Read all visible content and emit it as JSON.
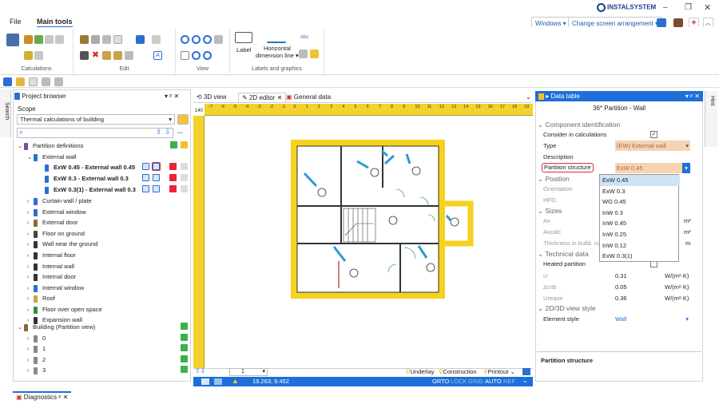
{
  "app": {
    "brand": "INSTALSYSTEM",
    "window_windows": "Windows",
    "window_arrangement": "Change screen arrangement"
  },
  "menu": {
    "file": "File",
    "main_tools": "Main tools"
  },
  "ribbon": {
    "calculations": "Calculations",
    "edit": "Edit",
    "view": "View",
    "labels_graphics": "Labels and graphics",
    "label_btn": "Label",
    "dim_btn_1": "Horizontal",
    "dim_btn_2": "dimension line"
  },
  "project_browser": {
    "title": "Project browser",
    "scope_label": "Scope",
    "scope_value": "Thermal calculations of building",
    "tree": [
      {
        "label": "Partition definitions",
        "level": 0,
        "expanded": true,
        "bold": false
      },
      {
        "label": "External wall",
        "level": 1,
        "expanded": true,
        "bold": false
      },
      {
        "label": "ExW 0.45 - External wall 0.45",
        "level": 2,
        "bold": true
      },
      {
        "label": "ExW 0.3 - External wall 0.3",
        "level": 2,
        "bold": true
      },
      {
        "label": "ExW 0.3(1) - External wall 0.3",
        "level": 2,
        "bold": true
      },
      {
        "label": "Curtain wall / plate",
        "level": 1
      },
      {
        "label": "External window",
        "level": 1
      },
      {
        "label": "External door",
        "level": 1
      },
      {
        "label": "Floor on ground",
        "level": 1
      },
      {
        "label": "Wall near the ground",
        "level": 1
      },
      {
        "label": "Internal floor",
        "level": 1
      },
      {
        "label": "Internal wall",
        "level": 1
      },
      {
        "label": "Internal door",
        "level": 1
      },
      {
        "label": "Internal window",
        "level": 1
      },
      {
        "label": "Roof",
        "level": 1
      },
      {
        "label": "Floor over open space",
        "level": 1
      },
      {
        "label": "Expansion wall",
        "level": 1
      },
      {
        "label": "Building (Partition view)",
        "level": 0,
        "expanded": true
      },
      {
        "label": "0",
        "level": 1
      },
      {
        "label": "1",
        "level": 1
      },
      {
        "label": "2",
        "level": 1
      },
      {
        "label": "3",
        "level": 1
      }
    ]
  },
  "side_tab_left": "Search",
  "side_tab_right": "Hint",
  "editor": {
    "tabs": [
      "3D view",
      "2D editor",
      "General data"
    ],
    "ruler_ticks": [
      "-7",
      "-6",
      "-5",
      "-4",
      "-3",
      "-2",
      "-1",
      "0",
      "1",
      "2",
      "3",
      "4",
      "5",
      "6",
      "7",
      "8",
      "9",
      "10",
      "11",
      "12",
      "13",
      "14",
      "15",
      "16",
      "17",
      "18",
      "19"
    ],
    "vruler_start": "140",
    "floor_selector": "1",
    "underlay": "Underlay",
    "construction": "Construction",
    "printout": "Printout",
    "coords": "19.263; 9.452",
    "status_orto": "ORTO",
    "status_lock": "LOCK",
    "status_grid": "GRID",
    "status_auto": "AUTO",
    "status_ref": "REF"
  },
  "data_table": {
    "title": "Data table",
    "subtitle": "36* Partition - Wall",
    "sections": {
      "component": "Component identification",
      "position": "Position",
      "sizes": "Sizes",
      "technical": "Technical data",
      "view": "2D/3D view style"
    },
    "rows": {
      "consider": "Consider in calculations",
      "type": "Type",
      "type_value": "(EW) External wall",
      "description": "Description",
      "partition_structure": "Partition structure",
      "partition_value": "ExW 0.45",
      "orientation": "Orientation",
      "hfd": "HFD.",
      "ax": "Ax",
      "axcalc": "Axcalc",
      "thickness": "Thickness in build. con",
      "heated": "Heated partition",
      "u": "U",
      "u_value": "0.31",
      "u_unit": "W/(m²·K)",
      "dutb": "ΔUtb",
      "dutb_value": "0.05",
      "dutb_unit": "W/(m²·K)",
      "ureq": "Urequir",
      "ureq_value": "0.36",
      "ureq_unit": "W/(m²·K)",
      "element_style": "Element style",
      "element_style_value": "Wall",
      "unit_m2": "m²",
      "unit_m": "m"
    },
    "dropdown": [
      "ExW 0.45",
      "ExW 0.3",
      "WG 0.45",
      "InW 0.3",
      "InW 0.45",
      "InW 0.25",
      "InW 0.12",
      "ExW 0.3(1)"
    ],
    "footer": "Partition structure"
  },
  "bottom_tab": "Diagnostics",
  "colors": {
    "accent": "#1e6fd9",
    "wall": "#f5d21e",
    "tree_blue": "#1e6fd9",
    "highlight": "#cfe3f7",
    "orange_field": "#f7d3b3"
  }
}
